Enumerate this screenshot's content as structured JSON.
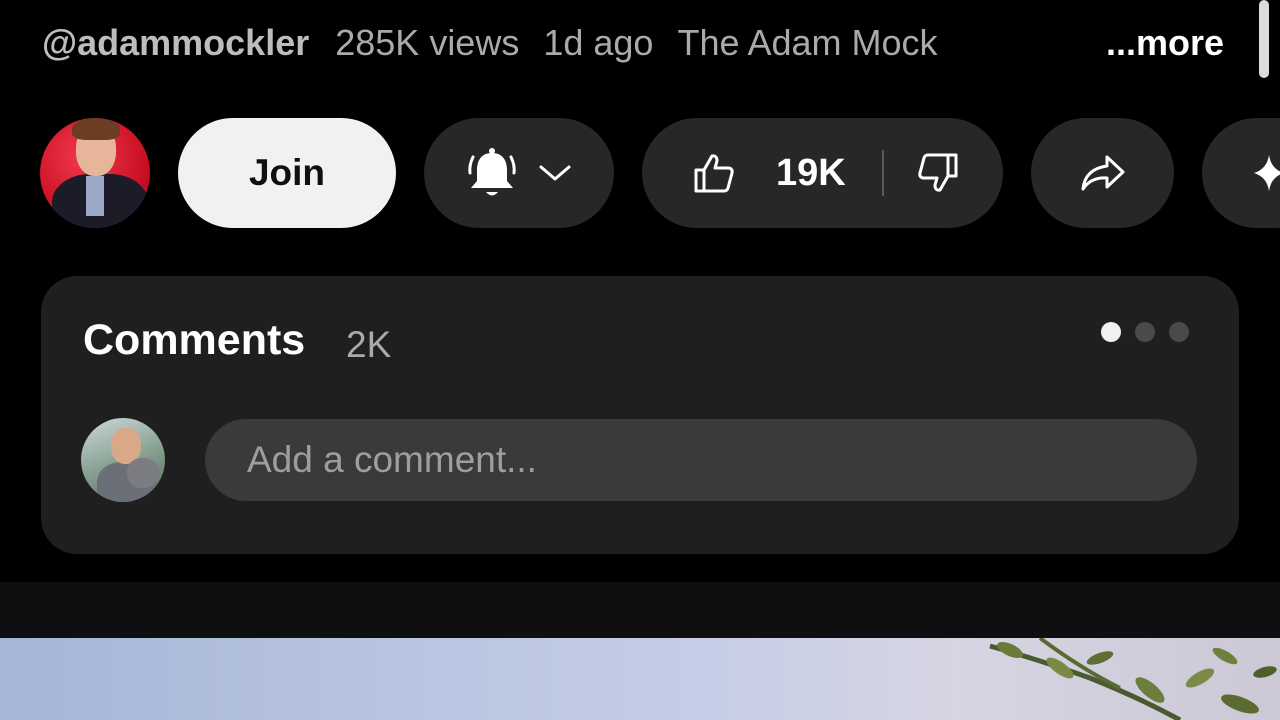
{
  "meta": {
    "channel_handle": "@adammockler",
    "views": "285K views",
    "age": "1d ago",
    "description_preview": "The Adam Mock",
    "more_label": "...more"
  },
  "actions": {
    "join_label": "Join",
    "like_count": "19K"
  },
  "comments": {
    "title": "Comments",
    "count": "2K",
    "input_placeholder": "Add a comment...",
    "pager_pages": 3,
    "pager_active_index": 0
  },
  "icons": {
    "bell": "bell-icon",
    "chevron": "chevron-down-icon",
    "like": "thumbs-up-icon",
    "dislike": "thumbs-down-icon",
    "share": "share-icon",
    "sparkle": "sparkle-icon"
  },
  "colors": {
    "background": "#000000",
    "pill": "#272727",
    "card": "#1f1f1f",
    "join_button": "#f1f1f1",
    "secondary_text": "#aaaaaa"
  }
}
